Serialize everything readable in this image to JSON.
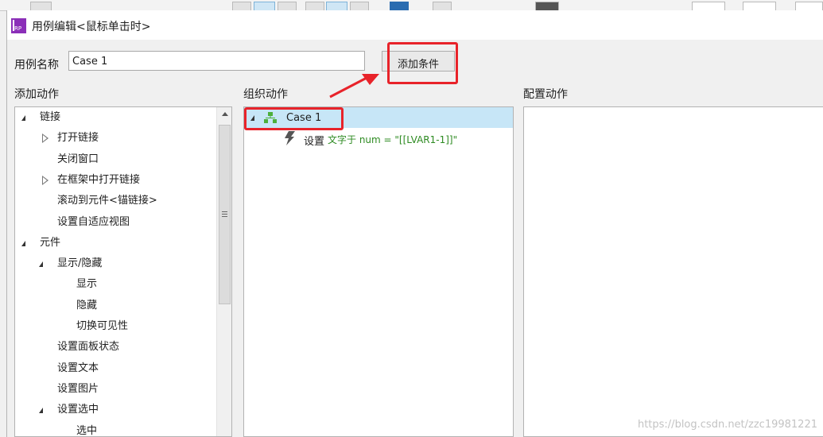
{
  "dialog": {
    "title": "用例编辑<鼠标单击时>",
    "app_icon_text": "RP"
  },
  "case_name": {
    "label": "用例名称",
    "value": "Case 1",
    "add_condition_label": "添加条件"
  },
  "sections": {
    "add_actions": "添加动作",
    "organize_actions": "组织动作",
    "configure_actions": "配置动作"
  },
  "actions_tree": [
    {
      "label": "链接",
      "level": 0,
      "state": "expanded"
    },
    {
      "label": "打开链接",
      "level": 1,
      "state": "collapsed"
    },
    {
      "label": "关闭窗口",
      "level": 1,
      "state": "leaf"
    },
    {
      "label": "在框架中打开链接",
      "level": 1,
      "state": "collapsed"
    },
    {
      "label": "滚动到元件<锚链接>",
      "level": 1,
      "state": "leaf"
    },
    {
      "label": "设置自适应视图",
      "level": 1,
      "state": "leaf"
    },
    {
      "label": "元件",
      "level": 0,
      "state": "expanded"
    },
    {
      "label": "显示/隐藏",
      "level": 1,
      "state": "expanded"
    },
    {
      "label": "显示",
      "level": 2,
      "state": "leaf"
    },
    {
      "label": "隐藏",
      "level": 2,
      "state": "leaf"
    },
    {
      "label": "切换可见性",
      "level": 2,
      "state": "leaf"
    },
    {
      "label": "设置面板状态",
      "level": 1,
      "state": "leaf"
    },
    {
      "label": "设置文本",
      "level": 1,
      "state": "leaf"
    },
    {
      "label": "设置图片",
      "level": 1,
      "state": "leaf"
    },
    {
      "label": "设置选中",
      "level": 1,
      "state": "expanded"
    },
    {
      "label": "选中",
      "level": 2,
      "state": "leaf"
    }
  ],
  "organize": {
    "case_label": "Case 1",
    "action_prefix": "设置",
    "action_detail": "文字于 num = \"[[LVAR1-1]]\""
  },
  "watermark": "https://blog.csdn.net/zzc19981221",
  "colors": {
    "accent_highlight": "#e8232a",
    "selection": "#c7e6f7",
    "detail_text": "#2e8b22",
    "app_icon": "#8b2fb8"
  }
}
